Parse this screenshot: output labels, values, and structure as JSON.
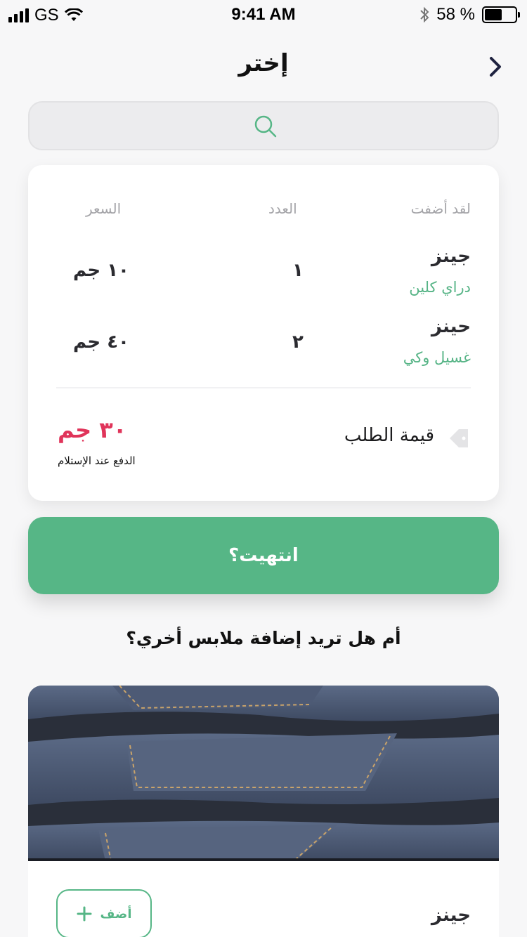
{
  "status_bar": {
    "carrier": "GS",
    "time": "9:41 AM",
    "battery_percent": "58 %",
    "battery_level": 0.58
  },
  "nav": {
    "title": "إختر",
    "back_icon": "chevron-right-icon"
  },
  "search": {
    "icon": "search-icon",
    "placeholder": ""
  },
  "order": {
    "headers": {
      "name": "لقد أضفت",
      "count": "العدد",
      "price": "السعر"
    },
    "items": [
      {
        "name": "جينز",
        "service": "دراي  كلين",
        "count": "١",
        "price": "١٠ جم"
      },
      {
        "name": "حينز",
        "service": "غسيل وكي",
        "count": "٢",
        "price": "٤٠ جم"
      }
    ],
    "total_label": "قيمة الطلب",
    "total_value": "٣٠ جم",
    "payment_note": "الدفع عند الإستلام",
    "tag_icon": "tag-icon"
  },
  "done_button": {
    "label": "انتهيت؟"
  },
  "add_more_question": "أم هل تريد إضافة ملابس أخري؟",
  "product": {
    "name": "جينز",
    "add_label": "أضف",
    "add_icon": "plus-icon",
    "image": "jeans-photo"
  },
  "colors": {
    "accent": "#56b686",
    "total": "#e0345a",
    "background": "#f7f7f8"
  }
}
